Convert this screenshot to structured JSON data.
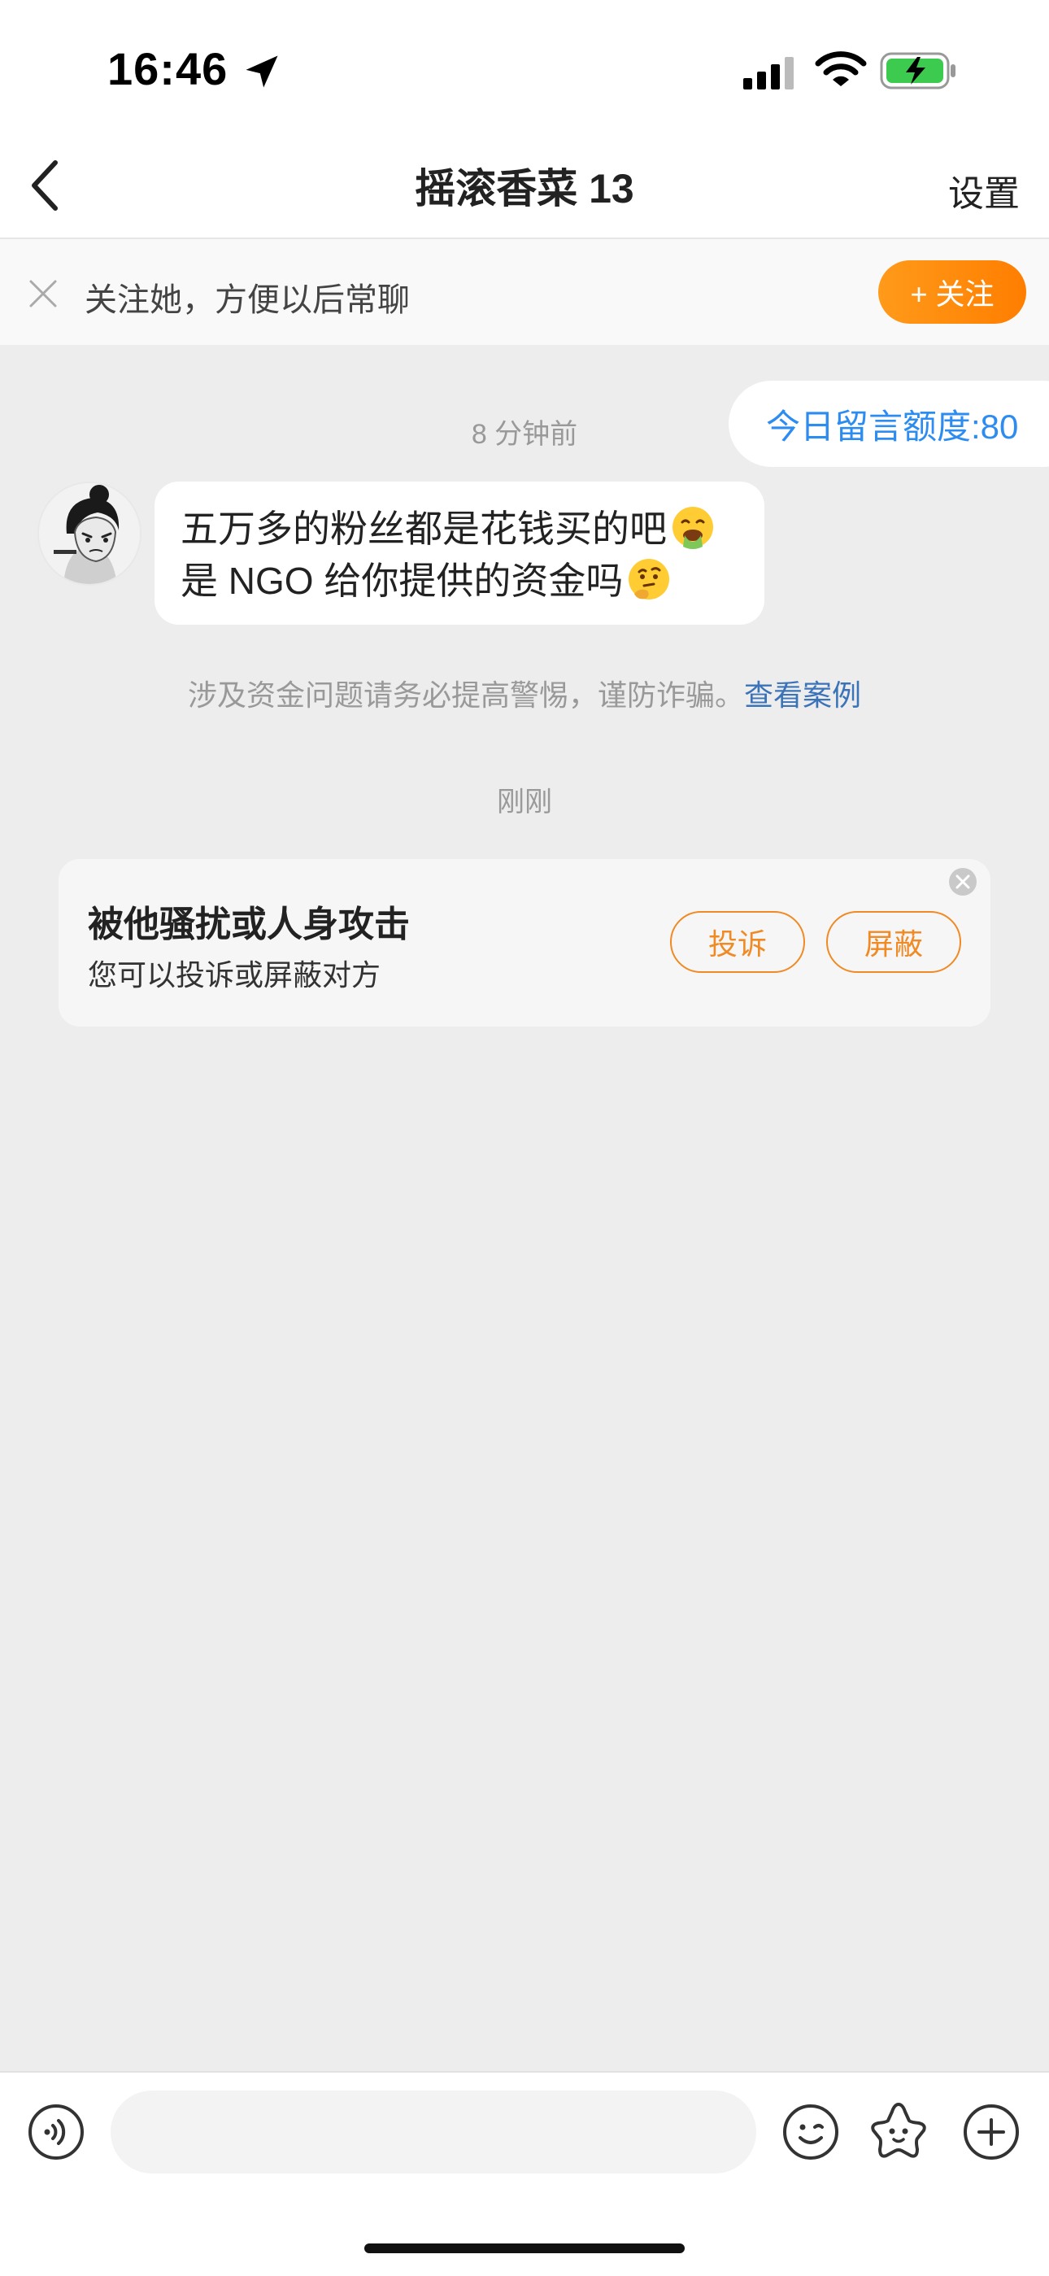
{
  "status_bar": {
    "time": "16:46"
  },
  "nav": {
    "title": "摇滚香菜 13",
    "settings_label": "设置"
  },
  "follow_bar": {
    "text": "关注她，方便以后常聊",
    "button_label": "+ 关注"
  },
  "chat": {
    "quota_label": "今日留言额度:80",
    "timestamp_1": "8 分钟前",
    "incoming_message": {
      "line1": "五万多的粉丝都是花钱买的吧",
      "line2": "是 NGO 给你提供的资金吗",
      "emoji_1": "vomiting-face",
      "emoji_2": "thinking-face"
    },
    "warning_text": "涉及资金问题请务必提高警惕，谨防诈骗。",
    "warning_link": "查看案例",
    "timestamp_2": "刚刚"
  },
  "harassment_card": {
    "title": "被他骚扰或人身攻击",
    "subtitle": "您可以投诉或屏蔽对方",
    "report_label": "投诉",
    "block_label": "屏蔽"
  },
  "input_bar": {
    "placeholder": ""
  },
  "colors": {
    "accent_orange": "#ff8a00",
    "link_blue": "#2d8cf0",
    "background": "#ededed"
  }
}
